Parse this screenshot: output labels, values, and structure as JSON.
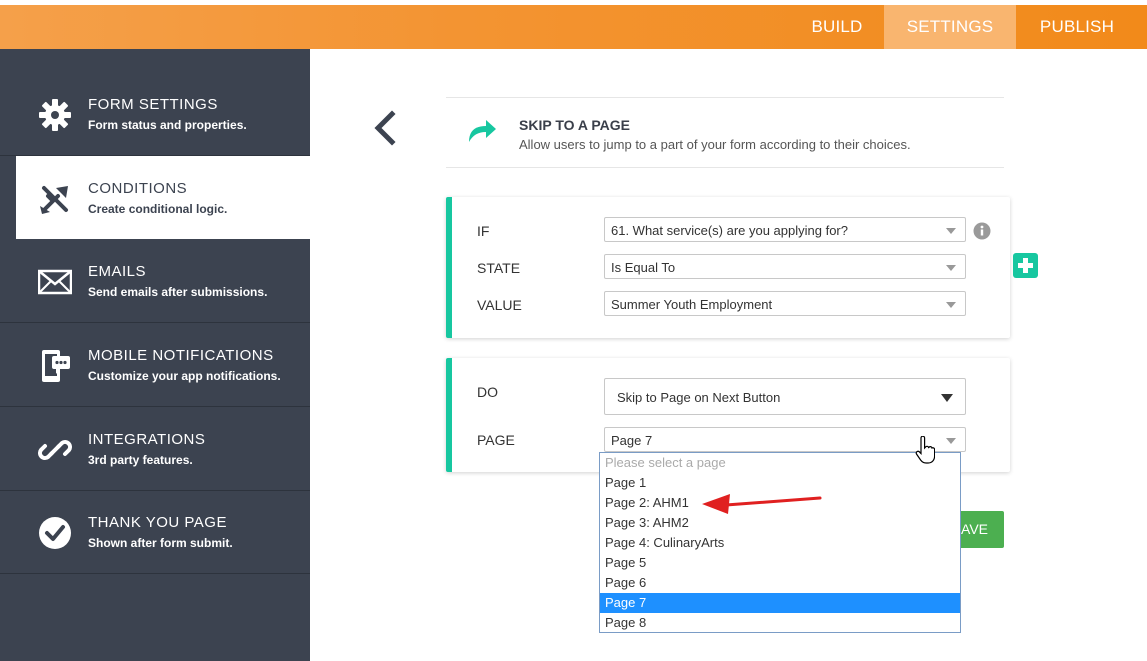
{
  "topbar": {
    "tabs": [
      {
        "label": "BUILD",
        "active": false
      },
      {
        "label": "SETTINGS",
        "active": true
      },
      {
        "label": "PUBLISH",
        "active": false
      }
    ],
    "accent": "#f39432"
  },
  "sidebar": {
    "items": [
      {
        "title": "FORM SETTINGS",
        "subtitle": "Form status and properties.",
        "icon": "gear-icon"
      },
      {
        "title": "CONDITIONS",
        "subtitle": "Create conditional logic.",
        "icon": "conditions-icon",
        "active": true
      },
      {
        "title": "EMAILS",
        "subtitle": "Send emails after submissions.",
        "icon": "envelope-icon"
      },
      {
        "title": "MOBILE NOTIFICATIONS",
        "subtitle": "Customize your app notifications.",
        "icon": "mobile-icon"
      },
      {
        "title": "INTEGRATIONS",
        "subtitle": "3rd party features.",
        "icon": "link-icon"
      },
      {
        "title": "THANK YOU PAGE",
        "subtitle": "Shown after form submit.",
        "icon": "check-circle-icon"
      }
    ]
  },
  "header": {
    "title": "SKIP TO A PAGE",
    "description": "Allow users to jump to a part of your form according to their choices."
  },
  "condition": {
    "if_label": "IF",
    "if_value": "61. What service(s) are you applying for?",
    "state_label": "STATE",
    "state_value": "Is Equal To",
    "value_label": "VALUE",
    "value_value": "Summer Youth Employment"
  },
  "action": {
    "do_label": "DO",
    "do_value": "Skip to Page on Next Button",
    "page_label": "PAGE",
    "page_value": "Page 7"
  },
  "dropdown": {
    "placeholder": "Please select a page",
    "options": [
      "Page 1",
      "Page 2: AHM1",
      "Page 3: AHM2",
      "Page 4: CulinaryArts",
      "Page 5",
      "Page 6",
      "Page 7",
      "Page 8"
    ],
    "highlighted": "Page 7"
  },
  "save_label": "AVE",
  "colors": {
    "sidebar_bg": "#3c4350",
    "teal": "#17c7a0",
    "save_green": "#4caf50",
    "highlight": "#1e90ff",
    "annotation_red": "#e02020"
  }
}
